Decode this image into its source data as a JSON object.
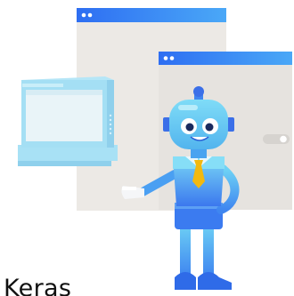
{
  "caption": {
    "text": "Keras"
  },
  "illustration": {
    "subject": "robot-computer-icon",
    "colors": {
      "window_bar": "#3f87f5",
      "window_body": "#ece9e5",
      "monitor": "#9fdcf3",
      "monitor_screen": "#e9f4f8",
      "robot_body": "#5cc3ee",
      "robot_dark": "#3d7ef0",
      "tie": "#f2b90f",
      "eye_white": "#ffffff",
      "eye_pupil": "#1a2a5e"
    }
  }
}
